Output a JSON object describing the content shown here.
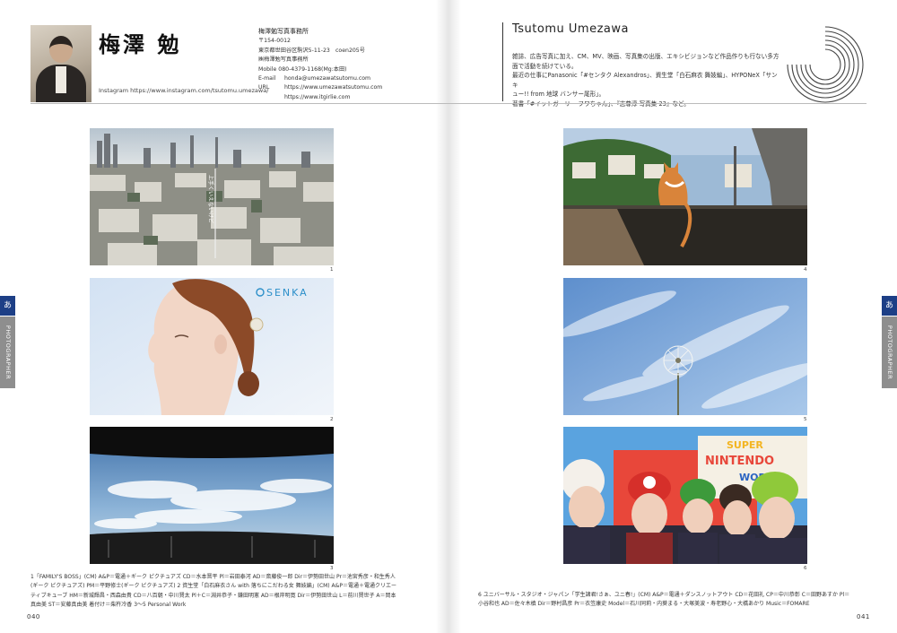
{
  "profile": {
    "name_ja": "梅澤 勉",
    "name_en": "Tsutomu Umezawa",
    "instagram": "Instagram   https://www.instagram.com/tsutomu.umezawa/",
    "office_name": "梅澤勉写真事務所",
    "postal": "〒154-0012",
    "address": "東京都世田谷区駒沢5-11-23　coen205号",
    "office_name_2": "㈱梅澤勉写真事務所",
    "mobile": "Mobile  080-4379-1168(Mg:本田)",
    "email_label": "E-mail",
    "email": "honda@umezawatsutomu.com",
    "url_label": "URL",
    "url_1": "https://www.umezawatsutomu.com",
    "url_2": "https://www.itgirlie.com",
    "bio": [
      "雑誌、広告写真に加え、CM、MV、映画、写真集の出版、エキシビジョンなど作品作りも行ない多方",
      "面で活動を続けている。",
      "最近の仕事にPanasonic「#センタク Alexandros」、資生堂「白石麻衣 舞妓編」、HYPONeX「サンキ",
      "ュー!! from 地球 バンサー尾形」。",
      "著書「#イットガーリー フワちゃん」、『志尊淳 写真集 23』など。"
    ]
  },
  "side_tabs": {
    "letter": "あ",
    "label": "PHOTOGRAPHER"
  },
  "photos": {
    "p1": {
      "number": "1",
      "overlay": "上手くいえないけど"
    },
    "p2": {
      "number": "2",
      "brand": "SENKA"
    },
    "p3": {
      "number": "3"
    },
    "p4": {
      "number": "4"
    },
    "p5": {
      "number": "5"
    },
    "p6": {
      "number": "6",
      "sign_1": "SUPER",
      "sign_2": "NINTENDO",
      "sign_3": "WORLD"
    }
  },
  "captions": {
    "left": [
      "1「FAMILY'S BOSS」(CM)  A&P＝電通＋ギーク ピクチュアズ  CD＝水本晋平  Pl＝岩田泰河  AD＝斎藤俊一郎  Dir＝伊勢田世山  Pr＝池宮秀彦・和生秀人",
      "(ギーク ピクチュアズ) PM＝平野修士(ギーク ピクチュアズ)   2 資生堂「白石麻衣さん with 落ちにこだわる女 舞妓編」(CM)  A&P＝電通＋電通クリエー",
      "ティブキューブ  HM＝新城輝昌・西森由貴  CD＝八百朝・中川賢太  Pl＋C＝淵井恭子・鎌田明憲  AD＝根岸明寛  Dir＝伊勢田世山  L＝前川賢世子  A＝岡本",
      "真由美  ST＝安藤真由美  着付け＝柴杵冷香   3～5 Personal Work"
    ],
    "right": [
      "6 ユニバーサル・スタジオ・ジャパン「学生諸君!さぁ、ユニ春!」(CM)  A&P＝電通＋ダンスノットアウト  CD＝花田礼  CP＝中川恭彰  C＝田野あすか  Pl＝",
      "小谷和也  AD＝佐々木槙  Dir＝野村昌彦  Pr＝衣笠康史  Model＝石川同莉・内葵まる・大塚美波・寿老野心・大橋あかり  Music＝FOMARE"
    ]
  },
  "folios": {
    "left": "040",
    "right": "041"
  }
}
